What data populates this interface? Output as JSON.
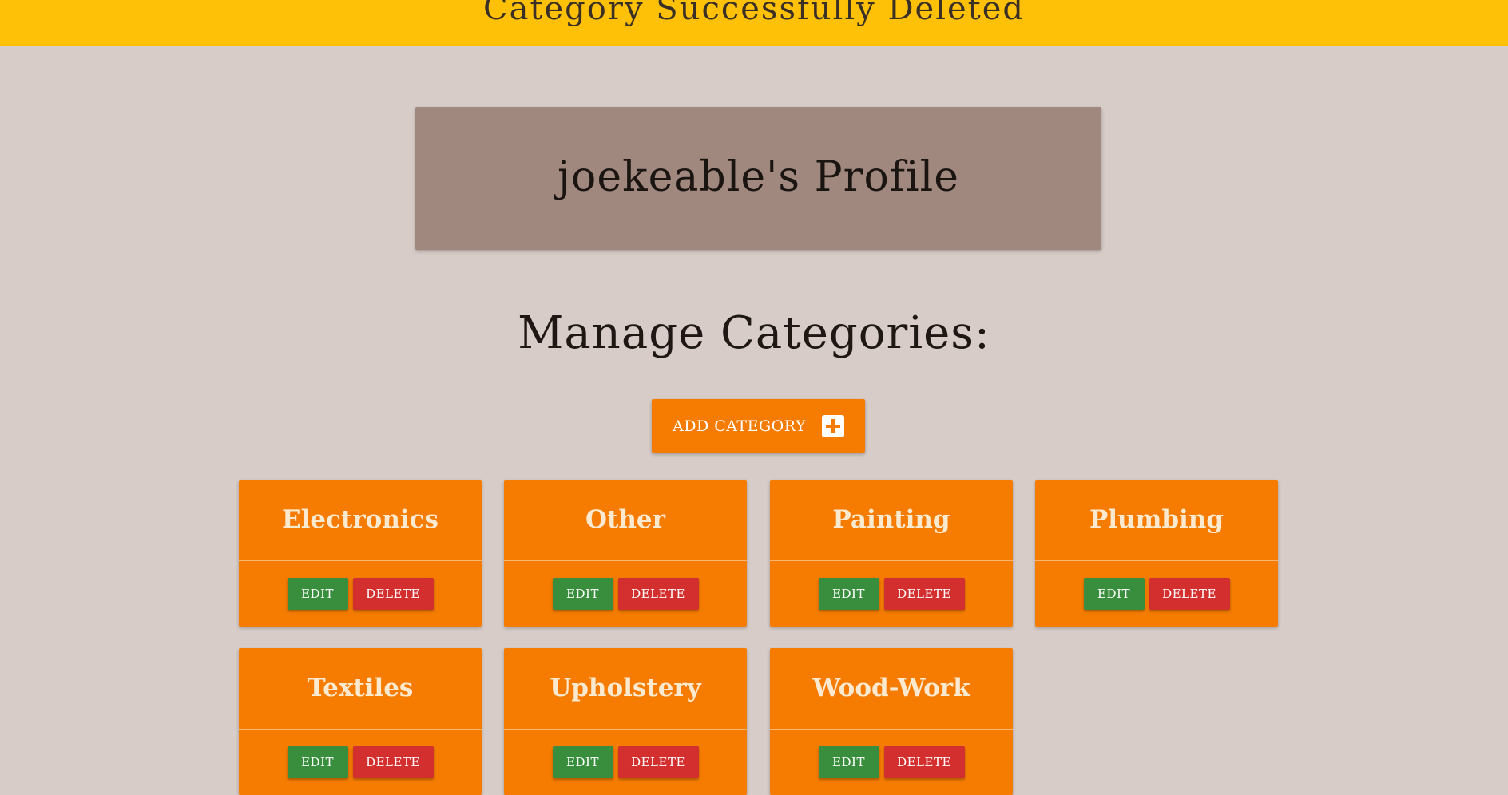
{
  "flash": {
    "message": "Category Successfully Deleted"
  },
  "profile": {
    "title": "joekeable's Profile"
  },
  "manage": {
    "title": "Manage Categories:",
    "add_label": "ADD CATEGORY"
  },
  "categories": [
    {
      "name": "Electronics",
      "edit_label": "EDIT",
      "delete_label": "DELETE"
    },
    {
      "name": "Other",
      "edit_label": "EDIT",
      "delete_label": "DELETE"
    },
    {
      "name": "Painting",
      "edit_label": "EDIT",
      "delete_label": "DELETE"
    },
    {
      "name": "Plumbing",
      "edit_label": "EDIT",
      "delete_label": "DELETE"
    },
    {
      "name": "Textiles",
      "edit_label": "EDIT",
      "delete_label": "DELETE"
    },
    {
      "name": "Upholstery",
      "edit_label": "EDIT",
      "delete_label": "DELETE"
    },
    {
      "name": "Wood-Work",
      "edit_label": "EDIT",
      "delete_label": "DELETE"
    }
  ],
  "colors": {
    "background": "#d7ccc8",
    "flash": "#ffc107",
    "profile_card": "#a1887f",
    "accent": "#f57c00",
    "edit": "#388e3c",
    "delete": "#d32f2f"
  },
  "icons": {
    "add": "plus-box-icon"
  }
}
